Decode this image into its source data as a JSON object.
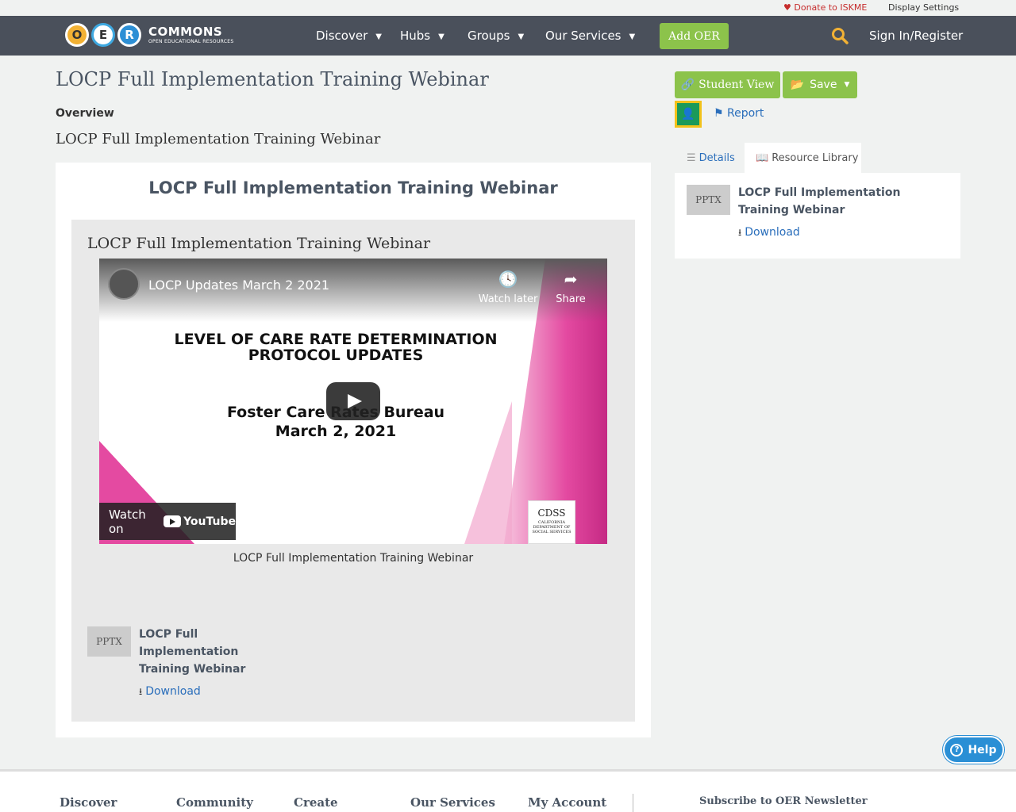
{
  "utility": {
    "donate": "Donate to ISKME",
    "display_settings": "Display Settings"
  },
  "nav": {
    "logo_letters": [
      "O",
      "E",
      "R"
    ],
    "logo_word": "COMMONS",
    "logo_tagline": "OPEN EDUCATIONAL RESOURCES",
    "items": [
      "Discover",
      "Hubs",
      "Groups",
      "Our Services"
    ],
    "add_oer": "Add OER",
    "sign_in": "Sign In/Register"
  },
  "page": {
    "title": "LOCP Full Implementation Training Webinar",
    "overview_label": "Overview",
    "overview_text": "LOCP Full Implementation Training Webinar",
    "card_title": "LOCP Full Implementation Training Webinar",
    "panel_title": "LOCP Full Implementation Training Webinar",
    "caption": "LOCP Full Implementation Training Webinar"
  },
  "video": {
    "title": "LOCP Updates March 2 2021",
    "watch_later": "Watch later",
    "share": "Share",
    "slide_heading_1": "LEVEL OF CARE RATE DETERMINATION",
    "slide_heading_2": "PROTOCOL UPDATES",
    "slide_sub_1": "Foster Care Rates Bureau",
    "slide_sub_2": "March 2, 2021",
    "watch_on": "Watch on",
    "youtube": "YouTube",
    "cdss": "CDSS",
    "cdss_small": "CALIFORNIA DEPARTMENT OF SOCIAL SERVICES"
  },
  "content_file": {
    "type": "PPTX",
    "name": "LOCP Full Implementation Training Webinar",
    "download": "Download"
  },
  "sidebar": {
    "student_view": "Student View",
    "save": "Save",
    "report": "Report",
    "tab_details": "Details",
    "tab_library": "Resource Library",
    "file_type": "PPTX",
    "file_name": "LOCP Full Implementation Training Webinar",
    "download": "Download"
  },
  "help": "Help",
  "footer": {
    "columns": [
      "Discover",
      "Community",
      "Create",
      "Our Services",
      "My Account"
    ],
    "newsletter": "Subscribe to OER Newsletter"
  },
  "colors": {
    "navbar": "#4a505b",
    "accent_green": "#8cc34b",
    "link_blue": "#2a6ebb",
    "donate_red": "#c62d2d"
  }
}
